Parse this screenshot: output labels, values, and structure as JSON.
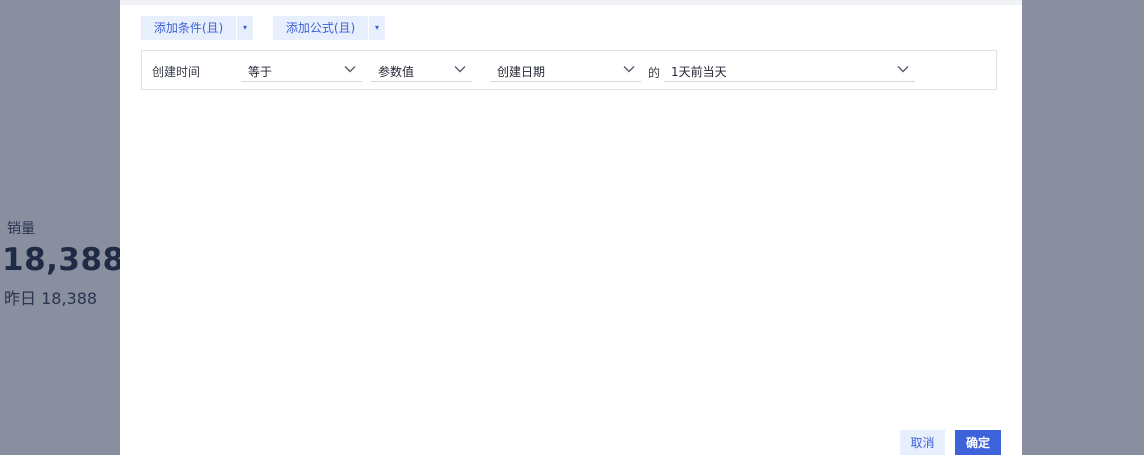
{
  "background_widget": {
    "label": "销量",
    "value": "18,388",
    "compare": "昨日 18,388"
  },
  "toolbar": {
    "add_condition_label": "添加条件(且)",
    "add_formula_label": "添加公式(且)",
    "caret_glyph": "▾"
  },
  "condition": {
    "field_label": "创建时间",
    "operator": "等于",
    "value_type": "参数值",
    "date_field": "创建日期",
    "of_text": "的",
    "relative_date": "1天前当天"
  },
  "footer": {
    "cancel_label": "取消",
    "ok_label": "确定"
  },
  "colors": {
    "overlay": "#8a8f9f",
    "accent": "#3d62d9",
    "accent_light": "#e8effc"
  }
}
